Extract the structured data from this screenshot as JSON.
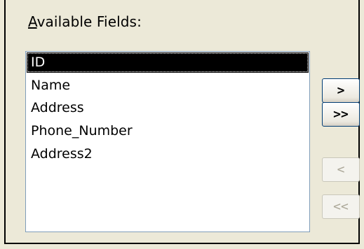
{
  "label": {
    "accel": "A",
    "rest": "vailable Fields:"
  },
  "fields": [
    "ID",
    "Name",
    "Address",
    "Phone_Number",
    "Address2"
  ],
  "selected_index": 0,
  "buttons": {
    "add_one": ">",
    "add_all": ">>",
    "remove_one": "<",
    "remove_all": "<<"
  },
  "colors": {
    "window_bg": "#ece9d8",
    "list_border": "#7f9db9",
    "selection_bg": "#000000",
    "selection_text": "#ffffff",
    "disabled_text": "#aca899"
  }
}
